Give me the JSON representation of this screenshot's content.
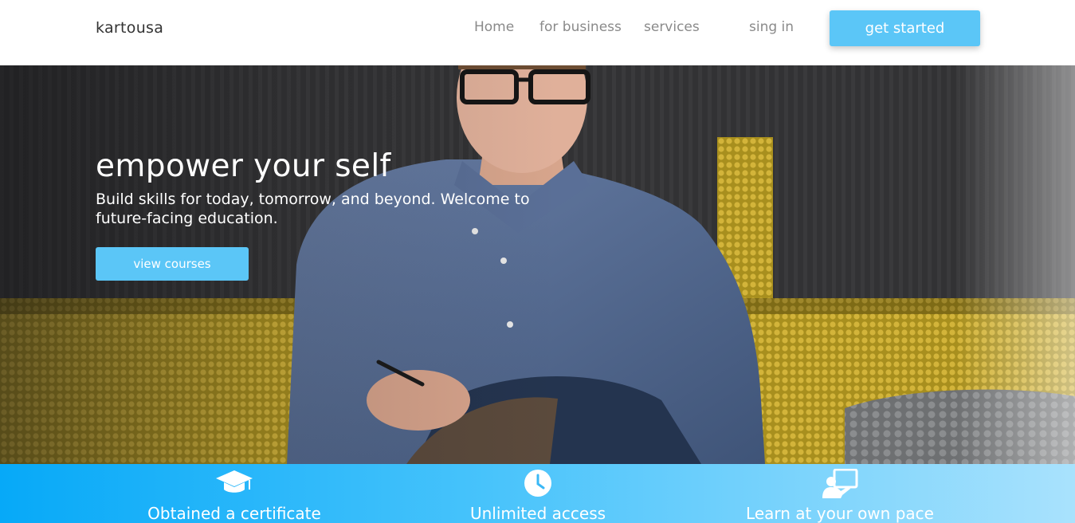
{
  "nav": {
    "brand": "kartousa",
    "links": [
      "Home",
      "for business",
      "services",
      "sing in"
    ],
    "cta_label": "get started"
  },
  "hero": {
    "title": "empower your self",
    "subtitle": "Build skills for today, tomorrow, and beyond. Welcome to future-facing education.",
    "button_label": "view courses"
  },
  "features": [
    {
      "label": "Obtained a certificate",
      "icon": "graduation-cap-icon"
    },
    {
      "label": "Unlimited access",
      "icon": "clock-icon"
    },
    {
      "label": "Learn at your own pace",
      "icon": "teacher-board-icon"
    }
  ],
  "colors": {
    "accent": "#5bc6f7",
    "feature_gradient_start": "#07a9f8",
    "feature_gradient_end": "#a9e2fd",
    "nav_text": "#8a8a8a"
  }
}
